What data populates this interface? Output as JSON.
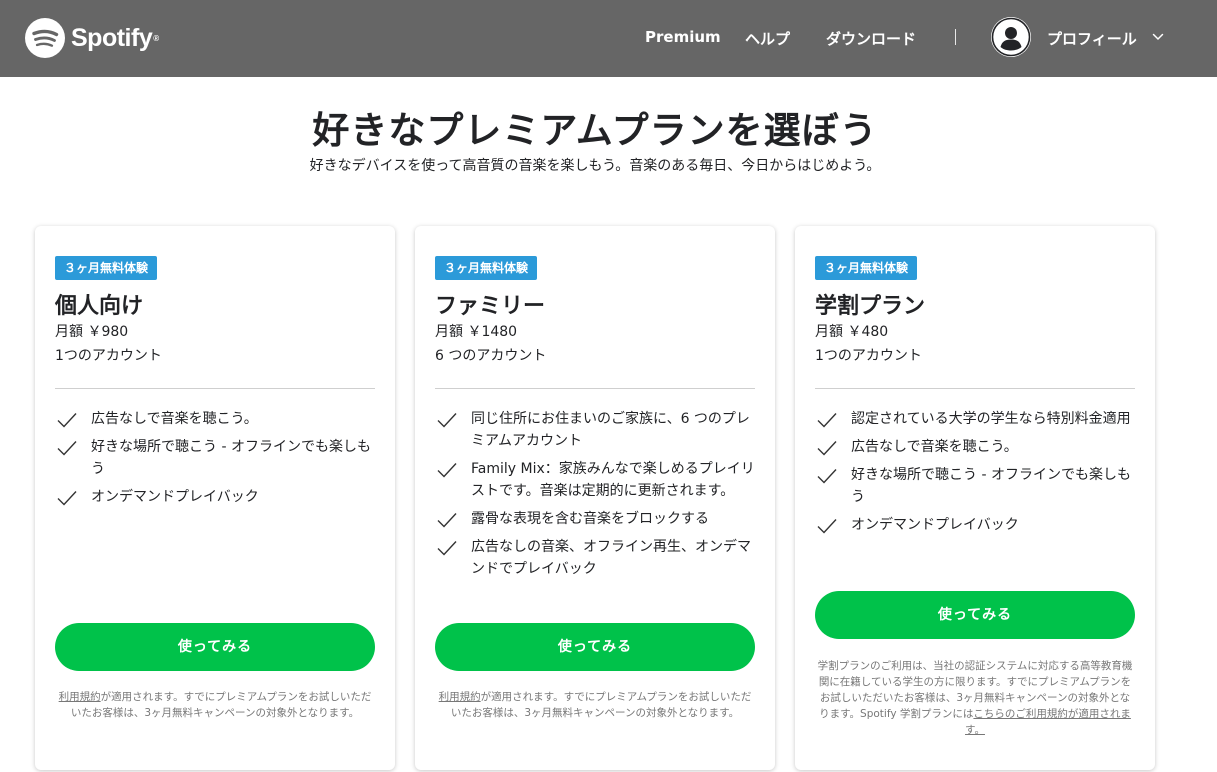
{
  "header": {
    "brand": "Spotify",
    "brand_mark": "®",
    "nav": [
      {
        "label": "Premium"
      },
      {
        "label": "ヘルプ"
      },
      {
        "label": "ダウンロード"
      }
    ],
    "profile_label": "プロフィール"
  },
  "hero": {
    "title": "好きなプレミアムプランを選ぼう",
    "subtitle": "好きなデバイスを使って高音質の音楽を楽しもう。音楽のある毎日、今日からはじめよう。"
  },
  "colors": {
    "header_bg": "#666666",
    "badge": "#2b9ad9",
    "cta": "#00c24a"
  },
  "plans": [
    {
      "badge": "３ヶ月無料体験",
      "name": "個人向け",
      "price": "月額 ￥980",
      "accounts": "1つのアカウント",
      "features": [
        "広告なしで音楽を聴こう。",
        "好きな場所で聴こう - オフラインでも楽しもう",
        "オンデマンドプレイバック"
      ],
      "cta": "使ってみる",
      "note_link": "利用規約",
      "note_text": "が適用されます。すでにプレミアムプランをお試しいただいたお客様は、3ヶ月無料キャンペーンの対象外となります。"
    },
    {
      "badge": "３ヶ月無料体験",
      "name": "ファミリー",
      "price": "月額 ￥1480",
      "accounts": "6 つのアカウント",
      "features": [
        "同じ住所にお住まいのご家族に、6 つのプレミアムアカウント",
        "Family Mix：家族みんなで楽しめるプレイリストです。音楽は定期的に更新されます。",
        "露骨な表現を含む音楽をブロックする",
        "広告なしの音楽、オフライン再生、オンデマンドでプレイバック"
      ],
      "cta": "使ってみる",
      "note_link": "利用規約",
      "note_text": "が適用されます。すでにプレミアムプランをお試しいただいたお客様は、3ヶ月無料キャンペーンの対象外となります。"
    },
    {
      "badge": "３ヶ月無料体験",
      "name": "学割プラン",
      "price": "月額 ￥480",
      "accounts": "1つのアカウント",
      "features": [
        "認定されている大学の学生なら特別料金適用",
        "広告なしで音楽を聴こう。",
        "好きな場所で聴こう - オフラインでも楽しもう",
        "オンデマンドプレイバック"
      ],
      "cta": "使ってみる",
      "note_text": "学割プランのご利用は、当社の認証システムに対応する高等教育機関に在籍している学生の方に限ります。すでにプレミアムプランをお試しいただいたお客様は、3ヶ月無料キャンペーンの対象外となります。Spotify 学割プランには",
      "note_link": "こちらのご利用規約が適用されます。"
    }
  ]
}
